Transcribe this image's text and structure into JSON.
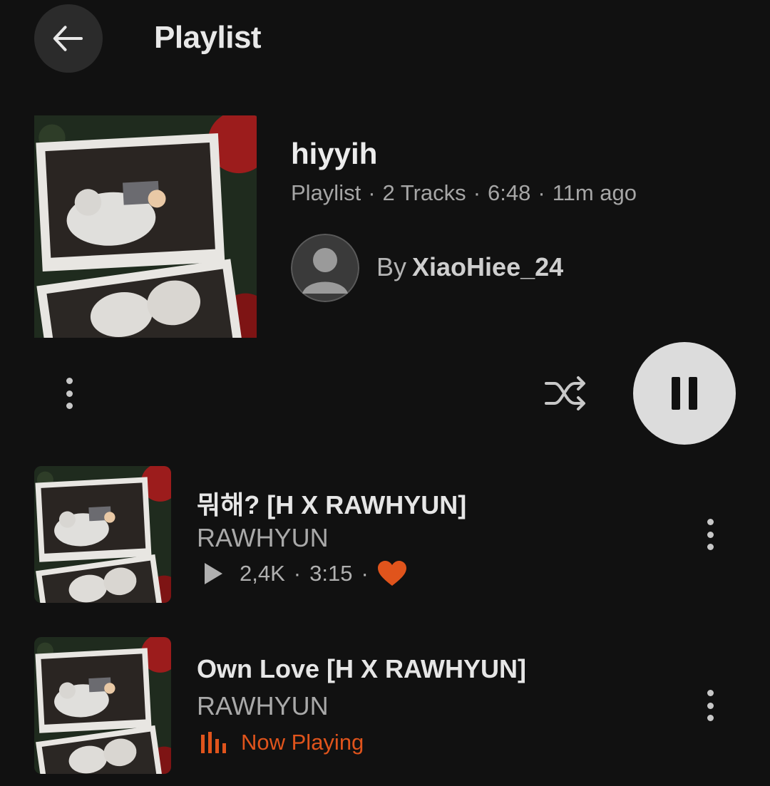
{
  "header": {
    "title": "Playlist",
    "back_icon": "arrow-left-icon"
  },
  "playlist": {
    "name": "hiyyih",
    "type": "Playlist",
    "tracks": "2 Tracks",
    "duration": "6:48",
    "updated": "11m ago",
    "by_label": "By",
    "owner": "XiaoHiee_24"
  },
  "controls": {
    "more_icon": "more-vertical-icon",
    "shuffle_icon": "shuffle-icon",
    "pause_icon": "pause-icon"
  },
  "tracks": [
    {
      "title": "뭐해? [H X RAWHYUN]",
      "artist": "RAWHYUN",
      "plays": "2,4K",
      "duration": "3:15",
      "liked": true
    },
    {
      "title": "Own Love [H X RAWHYUN]",
      "artist": "RAWHYUN",
      "status": "Now Playing"
    }
  ],
  "colors": {
    "background": "#111111",
    "accent": "#e0541c",
    "heart": "#e0541c"
  }
}
